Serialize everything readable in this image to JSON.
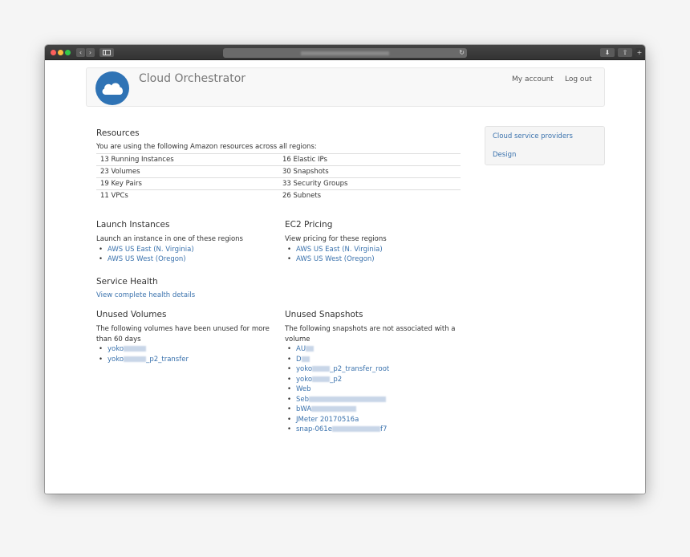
{
  "browser": {
    "back_glyph": "‹",
    "forward_glyph": "›",
    "reload_glyph": "↻",
    "download_glyph": "⬇",
    "share_glyph": "⇧",
    "plus_glyph": "+"
  },
  "header": {
    "brand": "Cloud Orchestrator",
    "logo_icon": "cloud-icon",
    "logo_color": "#2f73b5",
    "nav": {
      "account": "My account",
      "logout": "Log out"
    }
  },
  "sidebar": {
    "items": [
      {
        "label": "Cloud service providers"
      },
      {
        "label": "Design"
      }
    ]
  },
  "resources": {
    "title": "Resources",
    "intro": "You are using the following Amazon resources across all regions:",
    "rows": [
      {
        "left": "13 Running Instances",
        "right": "16 Elastic IPs"
      },
      {
        "left": "23 Volumes",
        "right": "30 Snapshots"
      },
      {
        "left": "19 Key Pairs",
        "right": "33 Security Groups"
      },
      {
        "left": "11 VPCs",
        "right": "26 Subnets"
      }
    ]
  },
  "launch": {
    "title": "Launch Instances",
    "intro": "Launch an instance in one of these regions",
    "regions": [
      "AWS US East (N. Virginia)",
      "AWS US West (Oregon)"
    ]
  },
  "pricing": {
    "title": "EC2 Pricing",
    "intro": "View pricing for these regions",
    "regions": [
      "AWS US East (N. Virginia)",
      "AWS US West (Oregon)"
    ]
  },
  "health": {
    "title": "Service Health",
    "link": "View complete health details"
  },
  "volumes": {
    "title": "Unused Volumes",
    "intro": "The following volumes have been unused for more than 60 days",
    "items": [
      {
        "prefix": "yoko",
        "suffix": ""
      },
      {
        "prefix": "yoko",
        "suffix": "_p2_transfer"
      }
    ]
  },
  "snapshots": {
    "title": "Unused Snapshots",
    "intro": "The following snapshots are not associated with a volume",
    "items": [
      {
        "prefix": "AU",
        "suffix": ""
      },
      {
        "prefix": "D",
        "suffix": ""
      },
      {
        "prefix": "yoko",
        "suffix": "_p2_transfer_root"
      },
      {
        "prefix": "yoko",
        "suffix": "_p2"
      },
      {
        "prefix": "Web",
        "suffix": ""
      },
      {
        "prefix": "Seb",
        "suffix": ""
      },
      {
        "prefix": "bWA",
        "suffix": ""
      },
      {
        "prefix": "JMeter 20170516a",
        "suffix": ""
      },
      {
        "prefix": "snap-061e",
        "suffix": "f7"
      }
    ]
  }
}
